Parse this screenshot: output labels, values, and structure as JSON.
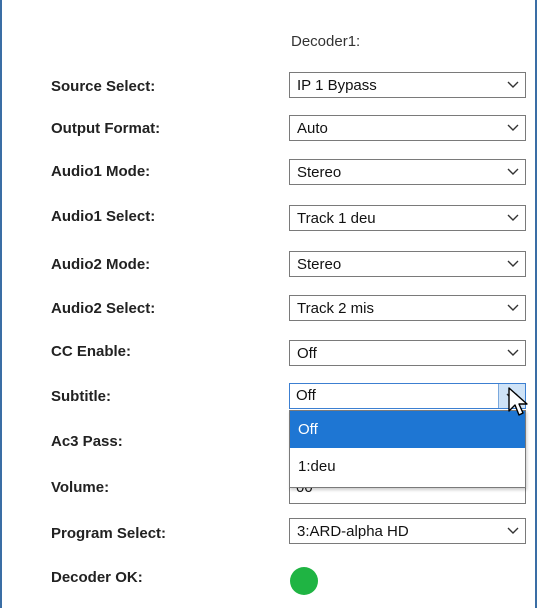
{
  "header": {
    "column_title": "Decoder1:"
  },
  "rows": [
    {
      "label": "Source Select:",
      "value": "IP 1 Bypass"
    },
    {
      "label": "Output Format:",
      "value": "Auto"
    },
    {
      "label": "Audio1 Mode:",
      "value": "Stereo"
    },
    {
      "label": "Audio1 Select:",
      "value": "Track 1 deu"
    },
    {
      "label": "Audio2 Mode:",
      "value": "Stereo"
    },
    {
      "label": "Audio2 Select:",
      "value": "Track 2 mis"
    },
    {
      "label": "CC Enable:",
      "value": "Off"
    },
    {
      "label": "Subtitle:",
      "value": "Off"
    },
    {
      "label": "Ac3 Pass:"
    },
    {
      "label": "Volume:",
      "value_partial": "00"
    },
    {
      "label": "Program Select:",
      "value": "3:ARD-alpha HD"
    },
    {
      "label": "Decoder OK:"
    }
  ],
  "subtitle_dropdown": {
    "options": [
      "Off",
      "1:deu"
    ],
    "highlighted_index": 0
  },
  "status": {
    "decoder_ok_color": "#1fb443"
  },
  "icons": {
    "chevron": "chevron-down-icon",
    "cursor": "mouse-pointer-icon"
  }
}
